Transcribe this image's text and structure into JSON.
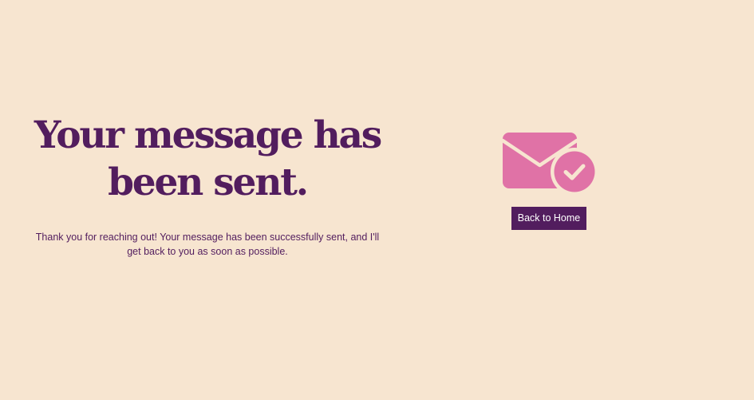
{
  "confirmation": {
    "headline": "Your message has been sent.",
    "message": "Thank you for reaching out! Your message has been successfully sent, and I'll get back to you as soon as possible."
  },
  "actions": {
    "back_home_label": "Back to Home"
  },
  "icon": {
    "name": "envelope-check-icon"
  },
  "colors": {
    "background": "#f7e5d0",
    "primary": "#521d5e",
    "accent": "#e072a6",
    "button_text": "#ffffff"
  }
}
